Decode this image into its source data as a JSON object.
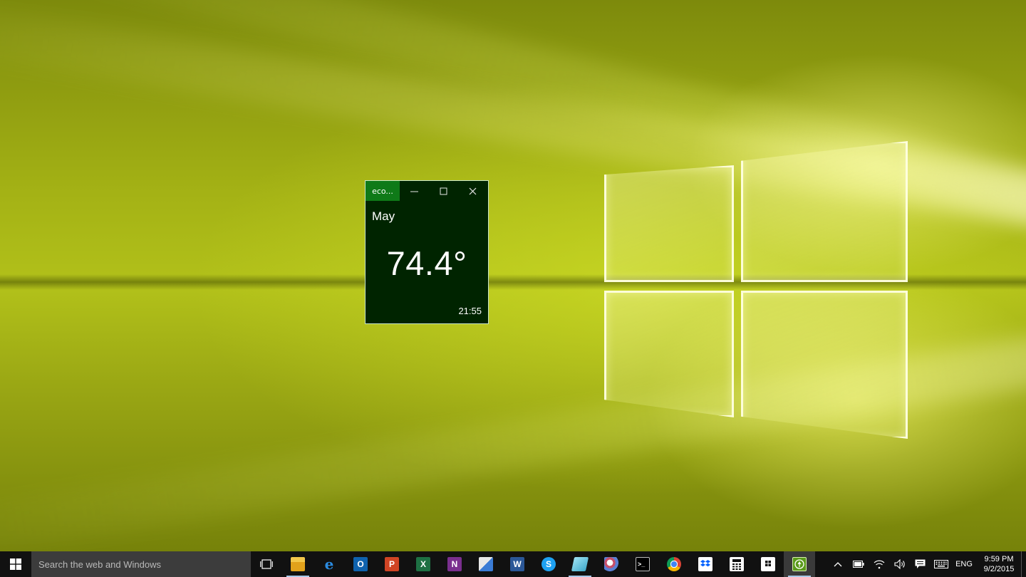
{
  "window": {
    "title": "eco...",
    "month": "May",
    "temperature": "74.4°",
    "time": "21:55"
  },
  "taskbar": {
    "search_placeholder": "Search the web and Windows",
    "apps": [
      {
        "name": "file-explorer",
        "label": ""
      },
      {
        "name": "edge",
        "label": "e"
      },
      {
        "name": "outlook",
        "label": "O"
      },
      {
        "name": "powerpoint",
        "label": "P"
      },
      {
        "name": "excel",
        "label": "X"
      },
      {
        "name": "onenote",
        "label": "N"
      },
      {
        "name": "paint",
        "label": ""
      },
      {
        "name": "word",
        "label": "W"
      },
      {
        "name": "skype",
        "label": "S"
      },
      {
        "name": "unknown-app",
        "label": ""
      },
      {
        "name": "remote-app",
        "label": ""
      },
      {
        "name": "command-prompt",
        "label": ">_"
      },
      {
        "name": "chrome",
        "label": ""
      },
      {
        "name": "dropbox",
        "label": ""
      },
      {
        "name": "calculator",
        "label": ""
      },
      {
        "name": "store",
        "label": ""
      },
      {
        "name": "eco-app",
        "label": ""
      }
    ],
    "tray": {
      "language": "ENG",
      "clock_time": "9:59 PM",
      "clock_date": "9/2/2015"
    }
  },
  "colors": {
    "window_bg": "#002400",
    "title_accent": "#0f7a18",
    "taskbar_bg": "#111111",
    "search_bg": "#3c3c3c"
  }
}
